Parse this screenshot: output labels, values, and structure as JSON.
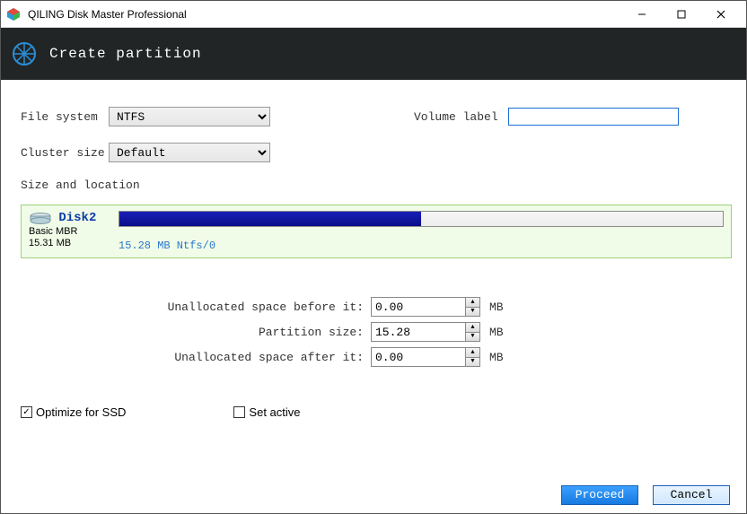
{
  "window": {
    "title": "QILING Disk Master Professional"
  },
  "header": {
    "title": "Create partition"
  },
  "form": {
    "file_system_label": "File system",
    "file_system_value": "NTFS",
    "cluster_size_label": "Cluster size",
    "cluster_size_value": "Default",
    "volume_label_label": "Volume label",
    "volume_label_value": ""
  },
  "section": {
    "size_location_label": "Size and location"
  },
  "disk": {
    "name": "Disk2",
    "type": "Basic MBR",
    "capacity": "15.31 MB",
    "bar_caption": "15.28 MB Ntfs/0",
    "fill_percent": 50
  },
  "sizes": {
    "before_label": "Unallocated space before it:",
    "before_value": "0.00",
    "size_label": "Partition size:",
    "size_value": "15.28",
    "after_label": "Unallocated space after it:",
    "after_value": "0.00",
    "unit": "MB"
  },
  "options": {
    "optimize_ssd_label": "Optimize for SSD",
    "optimize_ssd_checked": "✓",
    "set_active_label": "Set active",
    "set_active_checked": ""
  },
  "buttons": {
    "proceed": "Proceed",
    "cancel": "Cancel"
  }
}
